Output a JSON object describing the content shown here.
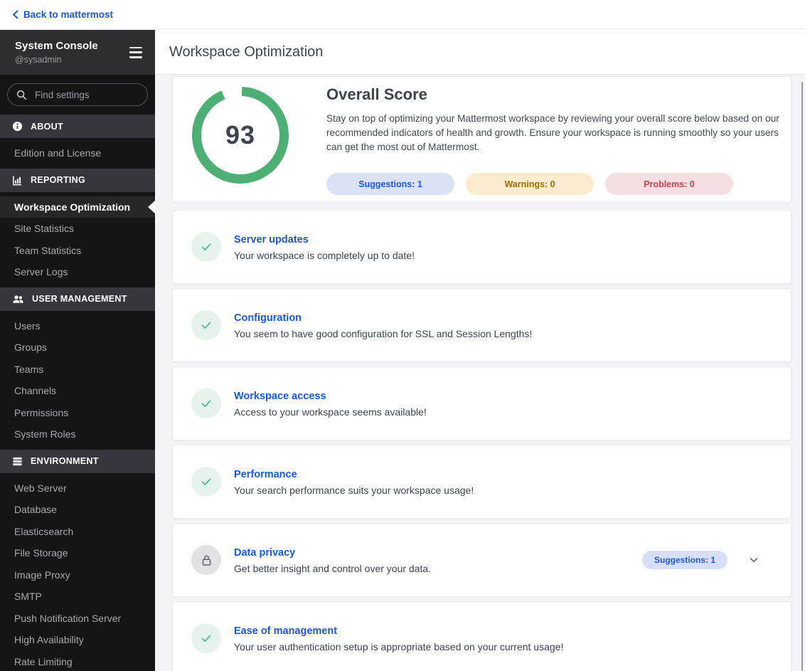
{
  "top_bar": {
    "back_label": "Back to mattermost"
  },
  "sidebar": {
    "title": "System Console",
    "subtitle": "@sysadmin",
    "search_placeholder": "Find settings",
    "sections": [
      {
        "label": "ABOUT",
        "icon": "info-icon",
        "items": [
          {
            "label": "Edition and License"
          }
        ]
      },
      {
        "label": "REPORTING",
        "icon": "bar-chart-icon",
        "items": [
          {
            "label": "Workspace Optimization",
            "selected": true
          },
          {
            "label": "Site Statistics"
          },
          {
            "label": "Team Statistics"
          },
          {
            "label": "Server Logs"
          }
        ]
      },
      {
        "label": "USER MANAGEMENT",
        "icon": "users-icon",
        "items": [
          {
            "label": "Users"
          },
          {
            "label": "Groups"
          },
          {
            "label": "Teams"
          },
          {
            "label": "Channels"
          },
          {
            "label": "Permissions"
          },
          {
            "label": "System Roles"
          }
        ]
      },
      {
        "label": "ENVIRONMENT",
        "icon": "server-icon",
        "items": [
          {
            "label": "Web Server"
          },
          {
            "label": "Database"
          },
          {
            "label": "Elasticsearch"
          },
          {
            "label": "File Storage"
          },
          {
            "label": "Image Proxy"
          },
          {
            "label": "SMTP"
          },
          {
            "label": "Push Notification Server"
          },
          {
            "label": "High Availability"
          },
          {
            "label": "Rate Limiting"
          }
        ]
      }
    ]
  },
  "header": {
    "title": "Workspace Optimization"
  },
  "overview": {
    "heading": "Overall Score",
    "score": "93",
    "score_percent": 93,
    "description": "Stay on top of optimizing your Mattermost workspace by reviewing your overall score below based on our recommended indicators of health and growth. Ensure your workspace is running smoothly so your users can get the most out of Mattermost.",
    "chips": [
      {
        "label": "Suggestions: 1",
        "type": "suggestions"
      },
      {
        "label": "Warnings: 0",
        "type": "warnings"
      },
      {
        "label": "Problems: 0",
        "type": "problems"
      }
    ]
  },
  "cards": [
    {
      "title": "Server updates",
      "description": "Your workspace is completely up to date!",
      "icon": "check"
    },
    {
      "title": "Configuration",
      "description": "You seem to have good configuration for SSL and Session Lengths!",
      "icon": "check"
    },
    {
      "title": "Workspace access",
      "description": "Access to your workspace seems available!",
      "icon": "check"
    },
    {
      "title": "Performance",
      "description": "Your search performance suits your workspace usage!",
      "icon": "check"
    },
    {
      "title": "Data privacy",
      "description": "Get better insight and control over your data.",
      "icon": "lock",
      "badge": "Suggestions: 1",
      "expandable": true
    },
    {
      "title": "Ease of management",
      "description": "Your user authentication setup is appropriate based on your current usage!",
      "icon": "check"
    }
  ],
  "colors": {
    "accent_blue": "#1c58d9",
    "success_green": "#3db887",
    "ring_green": "#4daf73",
    "suggestion_chip_bg": "#dbe2f6",
    "warning_chip_bg": "#fbeccd",
    "warning_text": "#9d6e00",
    "problem_chip_bg": "#f5dfe1",
    "problem_text": "#c8444e",
    "sidebar_bg": "#151515",
    "sidebar_header_bg": "#2e2e31",
    "section_header_bg": "#37373b",
    "content_bg": "#f4f4f6"
  }
}
